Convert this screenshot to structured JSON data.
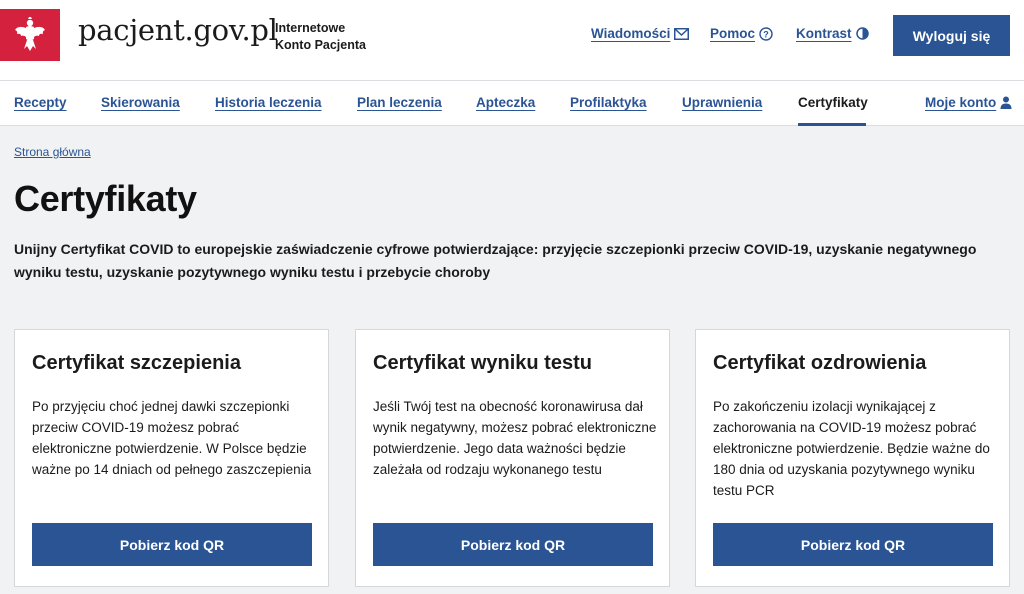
{
  "header": {
    "brand": "pacjent.gov.pl",
    "subtitle_line1": "Internetowe",
    "subtitle_line2": "Konto Pacjenta",
    "links": {
      "messages": "Wiadomości",
      "help": "Pomoc",
      "contrast": "Kontrast"
    },
    "logout_label": "Wyloguj się",
    "emblem_icon": "polish-eagle-icon"
  },
  "nav": {
    "items": [
      {
        "label": "Recepty"
      },
      {
        "label": "Skierowania"
      },
      {
        "label": "Historia leczenia"
      },
      {
        "label": "Plan leczenia"
      },
      {
        "label": "Apteczka"
      },
      {
        "label": "Profilaktyka"
      },
      {
        "label": "Uprawnienia"
      },
      {
        "label": "Certyfikaty",
        "active": true
      }
    ],
    "account_label": "Moje konto"
  },
  "breadcrumb": "Strona główna",
  "page": {
    "title": "Certyfikaty",
    "intro": "Unijny Certyfikat COVID to europejskie zaświadczenie cyfrowe potwierdzające: przyjęcie szczepionki przeciw COVID-19, uzyskanie negatywnego wyniku testu, uzyskanie pozytywnego wyniku testu i przebycie choroby"
  },
  "cards": [
    {
      "title": "Certyfikat szczepienia",
      "text": "Po przyjęciu choć jednej dawki szczepionki przeciw COVID-19 możesz pobrać elektroniczne potwierdzenie. W Polsce będzie ważne po 14 dniach od pełnego zaszczepienia",
      "button": "Pobierz kod QR"
    },
    {
      "title": "Certyfikat wyniku testu",
      "text": "Jeśli Twój test na obecność koronawirusa dał wynik negatywny, możesz pobrać elektroniczne potwierdzenie. Jego data ważności będzie zależała od rodzaju wykonanego testu",
      "button": "Pobierz kod QR"
    },
    {
      "title": "Certyfikat ozdrowienia",
      "text": "Po zakończeniu izolacji wynikającej z zachorowania na COVID-19 możesz pobrać elektroniczne potwierdzenie. Będzie ważne do 180 dnia od uzyskania pozytywnego wyniku testu PCR",
      "button": "Pobierz kod QR"
    }
  ],
  "colors": {
    "primary": "#2a5494",
    "emblem_red": "#d4213d",
    "background": "#f1f2f4"
  }
}
